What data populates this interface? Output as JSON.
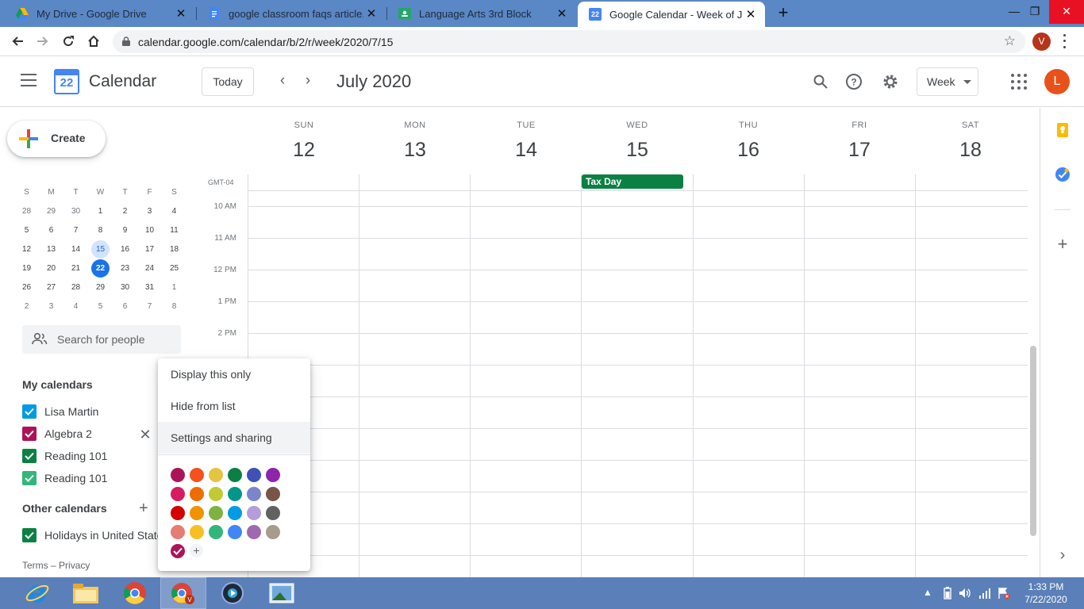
{
  "browser": {
    "tabs": [
      {
        "title": "My Drive - Google Drive",
        "icon": "google-drive-icon"
      },
      {
        "title": "google classroom faqs article.do",
        "icon": "google-docs-icon"
      },
      {
        "title": "Language Arts 3rd Block",
        "icon": "google-classroom-icon"
      },
      {
        "title": "Google Calendar - Week of July",
        "icon": "google-calendar-icon",
        "favicon_text": "22",
        "active": true
      }
    ],
    "url": "calendar.google.com/calendar/b/2/r/week/2020/7/15",
    "profile_initial": "V"
  },
  "header": {
    "logo_text": "22",
    "app_name": "Calendar",
    "today_label": "Today",
    "period_title": "July 2020",
    "view_label": "Week",
    "account_initial": "L"
  },
  "sidebar": {
    "create_label": "Create",
    "mini_calendar": {
      "weekdays": [
        "S",
        "M",
        "T",
        "W",
        "T",
        "F",
        "S"
      ],
      "weeks": [
        [
          "28",
          "29",
          "30",
          "1",
          "2",
          "3",
          "4"
        ],
        [
          "5",
          "6",
          "7",
          "8",
          "9",
          "10",
          "11"
        ],
        [
          "12",
          "13",
          "14",
          "15",
          "16",
          "17",
          "18"
        ],
        [
          "19",
          "20",
          "21",
          "22",
          "23",
          "24",
          "25"
        ],
        [
          "26",
          "27",
          "28",
          "29",
          "30",
          "31",
          "1"
        ],
        [
          "2",
          "3",
          "4",
          "5",
          "6",
          "7",
          "8"
        ]
      ]
    },
    "search_people_placeholder": "Search for people",
    "my_calendars_title": "My calendars",
    "my_calendars": [
      {
        "name": "Lisa Martin",
        "color": "#039be5"
      },
      {
        "name": "Algebra 2",
        "color": "#ad1457"
      },
      {
        "name": "Reading 101",
        "color": "#0b8043"
      },
      {
        "name": "Reading 101",
        "color": "#33b679"
      }
    ],
    "other_calendars_title": "Other calendars",
    "other_calendars": [
      {
        "name": "Holidays in United State",
        "color": "#0b8043"
      }
    ],
    "footer_terms": "Terms",
    "footer_sep": "–",
    "footer_privacy": "Privacy"
  },
  "week": {
    "days": [
      {
        "name": "SUN",
        "date": "12"
      },
      {
        "name": "MON",
        "date": "13"
      },
      {
        "name": "TUE",
        "date": "14"
      },
      {
        "name": "WED",
        "date": "15"
      },
      {
        "name": "THU",
        "date": "16"
      },
      {
        "name": "FRI",
        "date": "17"
      },
      {
        "name": "SAT",
        "date": "18"
      }
    ],
    "timezone": "GMT-04",
    "hours": [
      "10 AM",
      "11 AM",
      "12 PM",
      "1 PM",
      "2 PM"
    ],
    "allday_event": {
      "title": "Tax Day",
      "day": "WED",
      "color": "#0b8043"
    }
  },
  "context_menu": {
    "items": [
      "Display this only",
      "Hide from list",
      "Settings and sharing"
    ],
    "highlighted": "Settings and sharing",
    "colors": [
      [
        "#ad1457",
        "#f4511e",
        "#e4c441",
        "#0b8043",
        "#3f51b5",
        "#8e24aa"
      ],
      [
        "#d81b60",
        "#ef6c00",
        "#c0ca33",
        "#009688",
        "#7986cb",
        "#795548"
      ],
      [
        "#d50000",
        "#f09300",
        "#7cb342",
        "#039be5",
        "#b39ddb",
        "#616161"
      ],
      [
        "#e67c73",
        "#f6bf26",
        "#33b679",
        "#4285f4",
        "#9e69af",
        "#a79b8e"
      ]
    ],
    "selected_color": "#ad1457",
    "add_color_label": "+"
  },
  "taskbar": {
    "clock_time": "1:33 PM",
    "clock_date": "7/22/2020"
  }
}
